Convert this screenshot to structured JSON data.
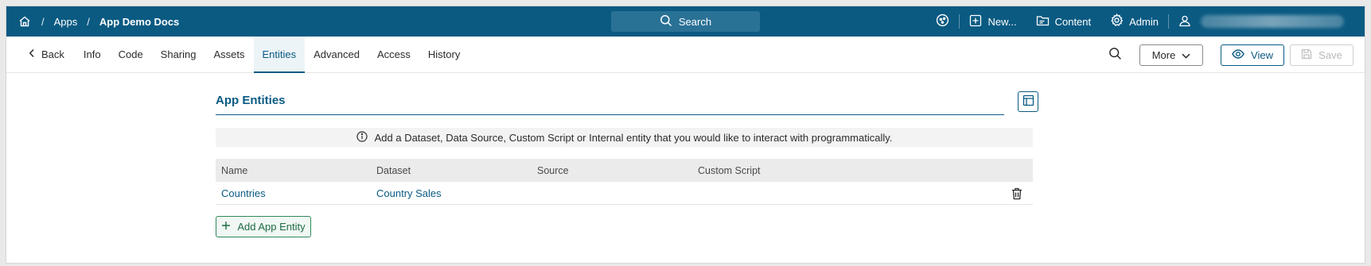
{
  "topbar": {
    "breadcrumb": [
      "Apps",
      "App Demo Docs"
    ],
    "search_label": "Search",
    "new_label": "New...",
    "content_label": "Content",
    "admin_label": "Admin"
  },
  "tabs": {
    "back_label": "Back",
    "items": [
      "Info",
      "Code",
      "Sharing",
      "Assets",
      "Entities",
      "Advanced",
      "Access",
      "History"
    ],
    "active": "Entities"
  },
  "actions": {
    "more_label": "More",
    "view_label": "View",
    "save_label": "Save"
  },
  "section": {
    "title": "App Entities",
    "info_text": "Add a Dataset, Data Source, Custom Script or Internal entity that you would like to interact with programmatically."
  },
  "table": {
    "columns": [
      "Name",
      "Dataset",
      "Source",
      "Custom Script"
    ],
    "rows": [
      {
        "name": "Countries",
        "dataset": "Country Sales",
        "source": "",
        "custom_script": ""
      }
    ]
  },
  "add_button_label": "Add App Entity",
  "colors": {
    "brand": "#0a5a82",
    "add_green": "#2f8a5a"
  }
}
